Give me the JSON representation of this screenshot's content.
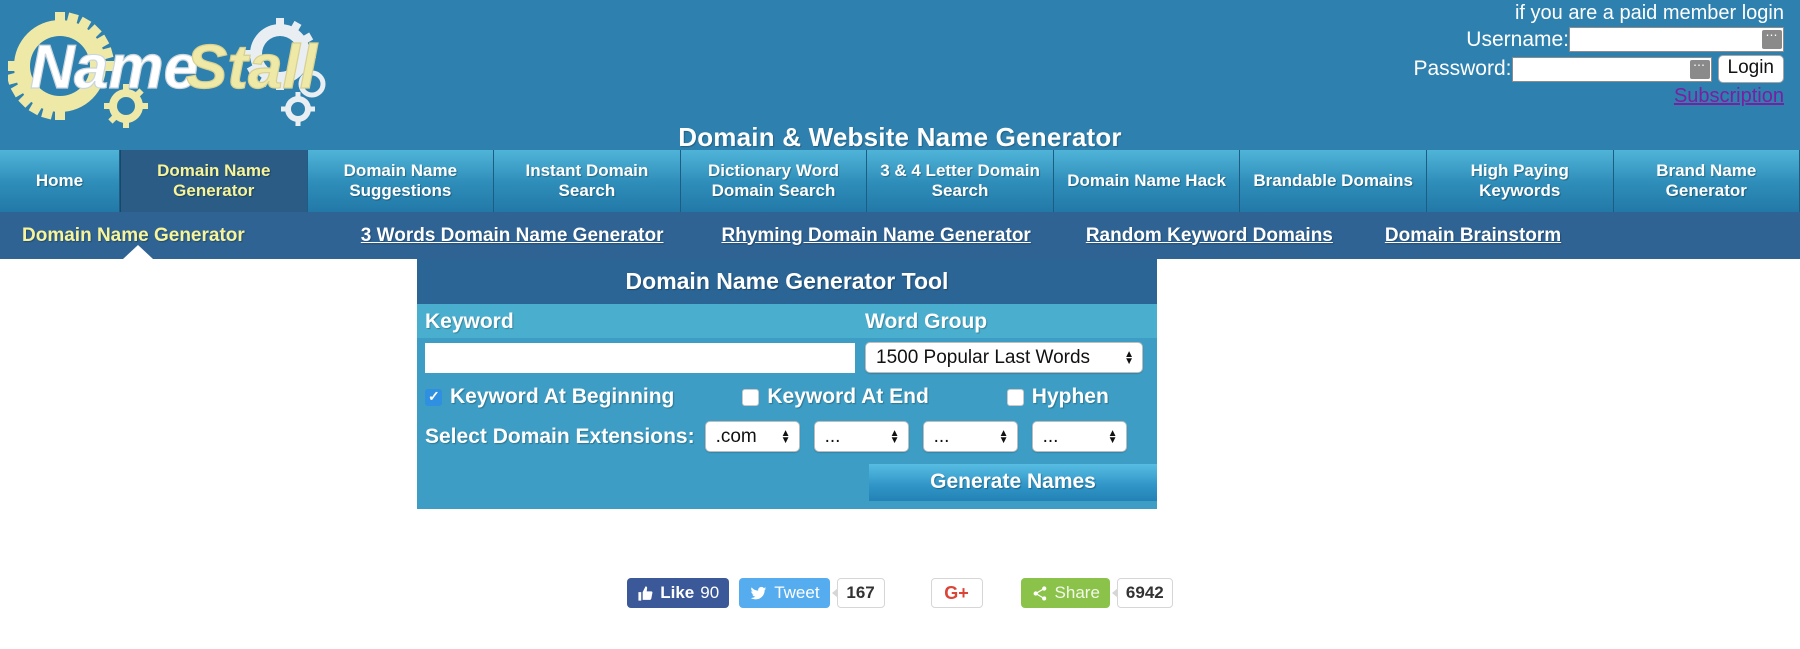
{
  "header": {
    "logo_text": "NameStall",
    "site_title": "Domain & Website Name Generator",
    "login": {
      "note": "if you are a paid member login",
      "username_label": "Username:",
      "password_label": "Password:",
      "username_value": "",
      "password_value": "",
      "login_button": "Login",
      "subscription_link": "Subscription",
      "subscription_color": "#7b1fa2"
    }
  },
  "mainnav": {
    "items": [
      {
        "label": "Home",
        "active": false
      },
      {
        "label": "Domain Name Generator",
        "active": true
      },
      {
        "label": "Domain Name Suggestions",
        "active": false
      },
      {
        "label": "Instant Domain Search",
        "active": false
      },
      {
        "label": "Dictionary Word Domain Search",
        "active": false
      },
      {
        "label": "3 & 4 Letter Domain Search",
        "active": false
      },
      {
        "label": "Domain Name Hack",
        "active": false
      },
      {
        "label": "Brandable Domains",
        "active": false
      },
      {
        "label": "High Paying Keywords",
        "active": false
      },
      {
        "label": "Brand Name Generator",
        "active": false
      }
    ],
    "active_color": "#f7f49a"
  },
  "subnav": {
    "items": [
      {
        "label": "Domain Name Generator",
        "active": true
      },
      {
        "label": "3 Words Domain Name Generator",
        "active": false
      },
      {
        "label": "Rhyming Domain Name Generator",
        "active": false
      },
      {
        "label": "Random Keyword Domains",
        "active": false
      },
      {
        "label": "Domain Brainstorm",
        "active": false
      }
    ]
  },
  "tool": {
    "title": "Domain Name Generator Tool",
    "keyword_label": "Keyword",
    "keyword_value": "",
    "keyword_placeholder": "",
    "wordgroup_label": "Word Group",
    "wordgroup_value": "1500 Popular Last Words",
    "checkboxes": [
      {
        "label": "Keyword At Beginning",
        "checked": true
      },
      {
        "label": "Keyword At End",
        "checked": false
      },
      {
        "label": "Hyphen",
        "checked": false
      }
    ],
    "extensions_label": "Select Domain Extensions:",
    "extensions": [
      "com",
      "...",
      "...",
      "..."
    ],
    "extension_values": [
      ".com",
      "...",
      "...",
      "..."
    ],
    "generate_button": "Generate Names"
  },
  "social": {
    "facebook": {
      "label": "Like",
      "count": "90"
    },
    "twitter": {
      "label": "Tweet",
      "count": "167"
    },
    "googleplus": {
      "label": "G+"
    },
    "share": {
      "label": "Share",
      "count": "6942"
    }
  }
}
